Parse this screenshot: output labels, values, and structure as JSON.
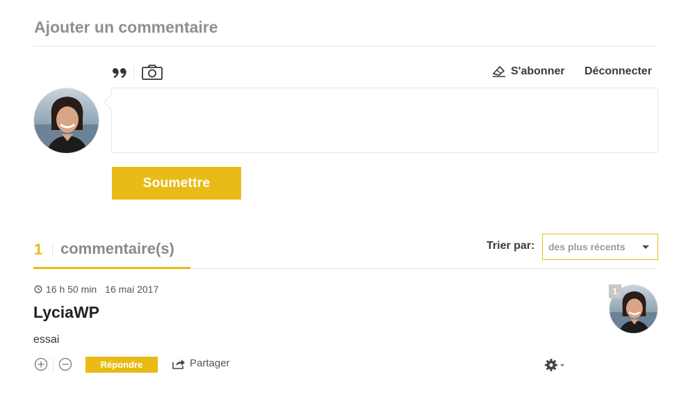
{
  "form": {
    "title": "Ajouter un commentaire",
    "subscribe_label": "S'abonner",
    "logout_label": "Déconnecter",
    "comment_value": "",
    "submit_label": "Soumettre"
  },
  "comments_header": {
    "count": "1",
    "count_label": "commentaire(s)",
    "sort_label": "Trier par:",
    "sort_selected": "des plus récents"
  },
  "comment": {
    "time": "16 h 50 min",
    "date": "16 mai 2017",
    "author": "LyciaWP",
    "text": "essai",
    "reply_label": "Répondre",
    "share_label": "Partager",
    "badge": "1"
  },
  "colors": {
    "accent": "#e8bb16",
    "title_gray": "#8f8f8f",
    "border": "#e6e6e6"
  },
  "icons": [
    "quote-icon",
    "camera-icon",
    "subscribe-icon",
    "clock-icon",
    "plus-circle-icon",
    "minus-circle-icon",
    "share-icon",
    "gear-icon"
  ]
}
